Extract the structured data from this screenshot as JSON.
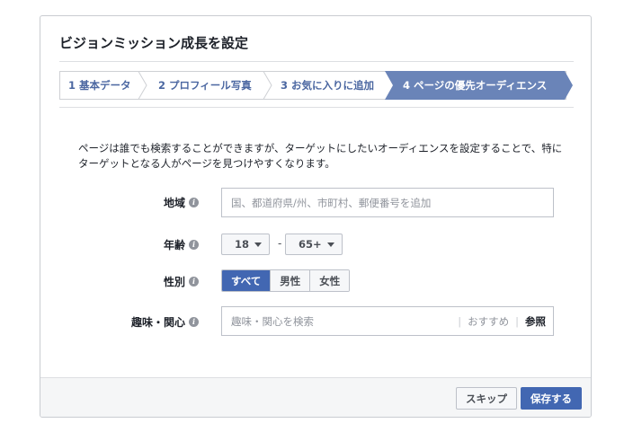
{
  "dialog": {
    "title": "ビジョンミッション成長を設定"
  },
  "steps": [
    {
      "label": "1 基本データ",
      "active": false
    },
    {
      "label": "2 プロフィール写真",
      "active": false
    },
    {
      "label": "3 お気に入りに追加",
      "active": false
    },
    {
      "label": "4 ページの優先オーディエンス",
      "active": true
    }
  ],
  "colors": {
    "accent": "#4267b2",
    "active_step": "#6a84b8",
    "step_text": "#4b67a1"
  },
  "intro": "ページは誰でも検索することができますが、ターゲットにしたいオーディエンスを設定することで、特にターゲットとなる人がページを見つけやすくなります。",
  "location": {
    "label": "地域",
    "placeholder": "国、都道府県/州、市町村、郵便番号を追加"
  },
  "age": {
    "label": "年齢",
    "min": "18",
    "max": "65+",
    "separator": "-"
  },
  "gender": {
    "label": "性別",
    "options": [
      "すべて",
      "男性",
      "女性"
    ],
    "selected": "すべて"
  },
  "interests": {
    "label": "趣味・関心",
    "placeholder": "趣味・関心を検索",
    "suggestions_label": "おすすめ",
    "browse_label": "参照"
  },
  "footer": {
    "skip_label": "スキップ",
    "save_label": "保存する"
  },
  "icons": {
    "info": "info-icon",
    "caret": "caret-down-icon"
  }
}
